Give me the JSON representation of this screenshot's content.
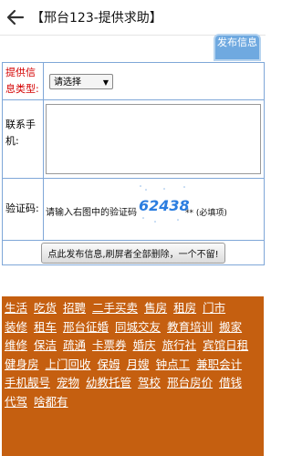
{
  "header": {
    "title": "【邢台123-提供求助】"
  },
  "publish": {
    "label": "发布信息"
  },
  "form": {
    "type_label": "提供信息类型:",
    "type_value": "请选择",
    "phone_label": "联系手机:",
    "phone_value": "",
    "captcha_label": "验证码:",
    "captcha_prompt": "请输入右图中的验证码",
    "captcha_code": "62438",
    "captcha_note": "** (必填项)",
    "submit_label": "点此发布信息,刷屏者全部删除，一个不留!"
  },
  "categories": [
    "生活",
    "吃货",
    "招聘",
    "二手买卖",
    "售房",
    "租房",
    "门市",
    "装修",
    "租车",
    "邢台征婚",
    "同城交友",
    "教育培训",
    "搬家",
    "维修",
    "保洁",
    "疏通",
    "卡票券",
    "婚庆",
    "旅行社",
    "宾馆日租",
    "健身房",
    "上门回收",
    "保姆",
    "月嫂",
    "钟点工",
    "兼职会计",
    "手机靓号",
    "宠物",
    "幼教托管",
    "驾校",
    "邢台房价",
    "借钱",
    "代驾",
    "啥都有"
  ],
  "colors": {
    "category_bg": "#c55f10",
    "publish_bg": "#6fa9e0",
    "required_label": "#d40000",
    "captcha_code": "#2b7de0"
  }
}
